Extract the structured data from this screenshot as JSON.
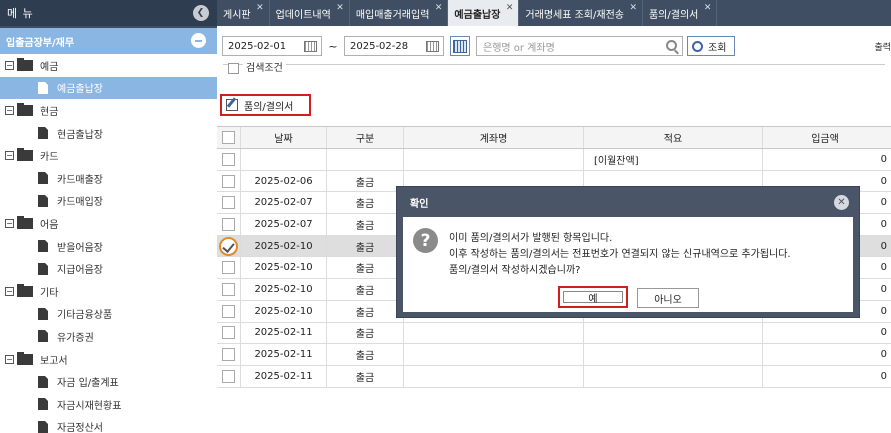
{
  "sidebar": {
    "title": "메 뉴",
    "toggle_icon": "chevron-left-icon",
    "section": "입출금장부/재무",
    "tree": [
      {
        "type": "folder",
        "label": "예금"
      },
      {
        "type": "leaf",
        "label": "예금출납장",
        "selected": true
      },
      {
        "type": "folder",
        "label": "현금"
      },
      {
        "type": "leaf",
        "label": "현금출납장"
      },
      {
        "type": "folder",
        "label": "카드"
      },
      {
        "type": "leaf",
        "label": "카드매출장"
      },
      {
        "type": "leaf",
        "label": "카드매입장"
      },
      {
        "type": "folder",
        "label": "어음"
      },
      {
        "type": "leaf",
        "label": "받을어음장"
      },
      {
        "type": "leaf",
        "label": "지급어음장"
      },
      {
        "type": "folder",
        "label": "기타"
      },
      {
        "type": "leaf",
        "label": "기타금융상품"
      },
      {
        "type": "leaf",
        "label": "유가증권"
      },
      {
        "type": "folder",
        "label": "보고서"
      },
      {
        "type": "leaf",
        "label": "자금 입/출계표"
      },
      {
        "type": "leaf",
        "label": "자금시재현황표"
      },
      {
        "type": "leaf",
        "label": "자금정산서"
      }
    ]
  },
  "tabs": [
    {
      "label": "게시판",
      "active": false
    },
    {
      "label": "업데이트내역",
      "active": false
    },
    {
      "label": "매입매출거래입력",
      "active": false
    },
    {
      "label": "예금출납장",
      "active": true
    },
    {
      "label": "거래명세표 조회/재전송",
      "active": false
    },
    {
      "label": "품의/결의서",
      "active": false
    }
  ],
  "filter": {
    "date_from": "2025-02-01",
    "tilde": "~",
    "date_to": "2025-02-28",
    "search_placeholder": "은행명 or 계좌명",
    "query_label": "조회",
    "out_label": "출력"
  },
  "condition_label": "검색조건",
  "voucher_button": "품의/결의서",
  "grid": {
    "headers": [
      "날짜",
      "구분",
      "계좌명",
      "적요",
      "입금액"
    ],
    "rows": [
      {
        "date": "",
        "type": "",
        "account": "",
        "memo": "[이월잔액]",
        "amount": "0"
      },
      {
        "date": "2025-02-06",
        "type": "출금",
        "account": "",
        "memo": "",
        "amount": "0"
      },
      {
        "date": "2025-02-07",
        "type": "출금",
        "account": "",
        "memo": "",
        "amount": "0"
      },
      {
        "date": "2025-02-07",
        "type": "출금",
        "account": "",
        "memo": "",
        "amount": "0"
      },
      {
        "date": "2025-02-10",
        "type": "출금",
        "account": "",
        "memo": "",
        "amount": "0",
        "checked": true
      },
      {
        "date": "2025-02-10",
        "type": "출금",
        "account": "",
        "memo": "",
        "amount": "0"
      },
      {
        "date": "2025-02-10",
        "type": "출금",
        "account": "",
        "memo": "",
        "amount": "0"
      },
      {
        "date": "2025-02-10",
        "type": "출금",
        "account": "",
        "memo": "",
        "amount": "0"
      },
      {
        "date": "2025-02-11",
        "type": "출금",
        "account": "",
        "memo": "",
        "amount": "0"
      },
      {
        "date": "2025-02-11",
        "type": "출금",
        "account": "",
        "memo": "",
        "amount": "0"
      },
      {
        "date": "2025-02-11",
        "type": "출금",
        "account": "",
        "memo": "",
        "amount": "0"
      }
    ]
  },
  "dialog": {
    "title": "확인",
    "line1": "이미 품의/결의서가 발행된 항목입니다.",
    "line2": "이후 작성하는 품의/결의서는 전표번호가 연결되지 않는 신규내역으로 추가됩니다.",
    "line3": "품의/결의서 작성하시겠습니까?",
    "yes": "예",
    "no": "아니오"
  },
  "colors": {
    "sidebar_bg": "#3f4e62",
    "selected": "#8ab6e3",
    "highlight": "#d21e1e"
  }
}
